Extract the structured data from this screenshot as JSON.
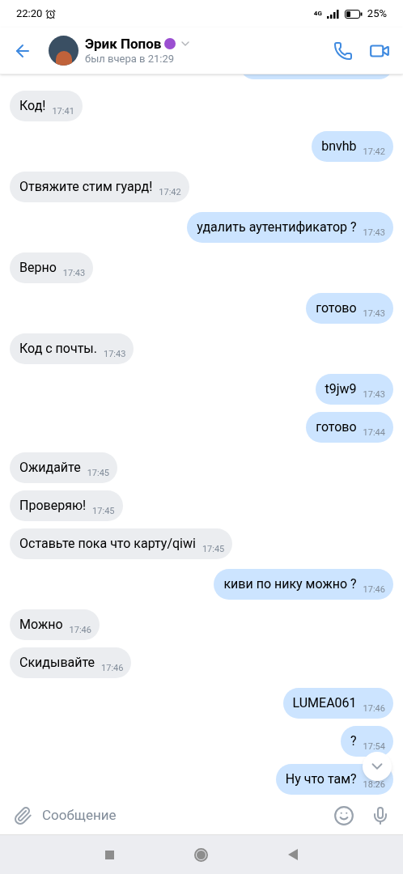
{
  "status_bar": {
    "time": "22:20",
    "battery": "25%",
    "network": "4G"
  },
  "header": {
    "name": "Эрик Попов",
    "status": "был вчера в 21:29"
  },
  "messages": [
    {
      "text": "Код!",
      "time": "17:41",
      "out": false
    },
    {
      "text": "bnvhb",
      "time": "17:42",
      "out": true
    },
    {
      "text": "Отвяжите стим гуард!",
      "time": "17:42",
      "out": false
    },
    {
      "text": "удалить аутентификатор ?",
      "time": "17:43",
      "out": true
    },
    {
      "text": "Верно",
      "time": "17:43",
      "out": false
    },
    {
      "text": "готово",
      "time": "17:43",
      "out": true
    },
    {
      "text": "Код с почты.",
      "time": "17:43",
      "out": false
    },
    {
      "text": "t9jw9",
      "time": "17:43",
      "out": true
    },
    {
      "text": "готово",
      "time": "17:44",
      "out": true
    },
    {
      "text": "Ожидайте",
      "time": "17:45",
      "out": false
    },
    {
      "text": "Проверяю!",
      "time": "17:45",
      "out": false
    },
    {
      "text": "Оставьте пока что карту/qiwi",
      "time": "17:45",
      "out": false
    },
    {
      "text": "киви по нику можно ?",
      "time": "17:46",
      "out": true
    },
    {
      "text": "Можно",
      "time": "17:46",
      "out": false
    },
    {
      "text": "Скидывайте",
      "time": "17:46",
      "out": false
    },
    {
      "text": "LUMEA061",
      "time": "17:46",
      "out": true
    },
    {
      "text": "?",
      "time": "17:54",
      "out": true
    },
    {
      "text": "Ну что там?",
      "time": "18:26",
      "out": true
    }
  ],
  "composer": {
    "placeholder": "Сообщение"
  }
}
